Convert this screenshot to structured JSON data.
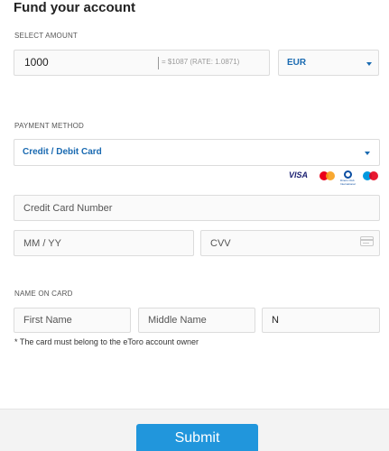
{
  "header": {
    "title": "Fund your account"
  },
  "amount_section": {
    "label": "SELECT AMOUNT",
    "amount_value": "1000",
    "conversion_text": "= $1087   (RATE: 1.0871)",
    "currency": "EUR"
  },
  "payment_section": {
    "label": "PAYMENT METHOD",
    "method": "Credit / Debit Card",
    "card_brands": {
      "visa": "VISA",
      "diners_small": "Diners Club International",
      "others": [
        "mastercard-icon",
        "diners-club-icon",
        "maestro-icon"
      ]
    },
    "card_number_placeholder": "Credit Card Number",
    "expiry_placeholder": "MM / YY",
    "cvv_placeholder": "CVV"
  },
  "name_section": {
    "label": "NAME ON CARD",
    "first_name_placeholder": "First Name",
    "middle_name_placeholder": "Middle Name",
    "last_name_value": "N",
    "note": "* The card must belong to the eToro account owner"
  },
  "footer": {
    "submit_label": "Submit"
  },
  "colors": {
    "accent": "#1a6ab1",
    "submit_bg": "#2196dc"
  }
}
